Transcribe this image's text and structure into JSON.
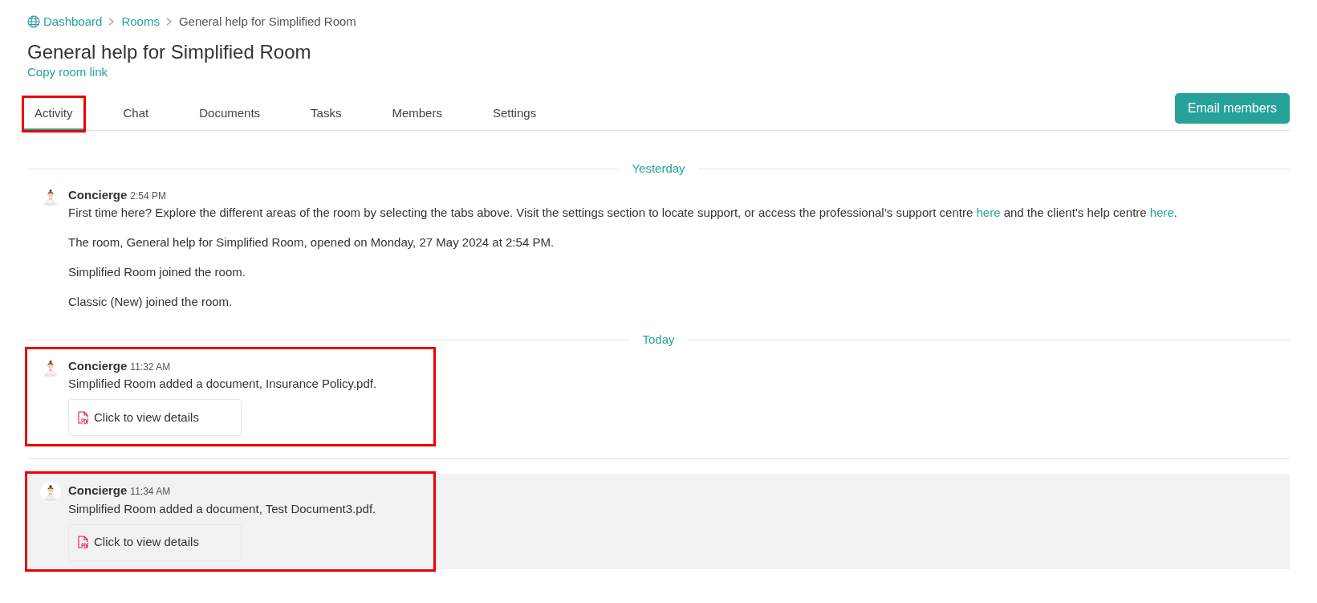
{
  "breadcrumb": [
    {
      "label": "Dashboard",
      "kind": "link"
    },
    {
      "label": "Rooms",
      "kind": "link"
    },
    {
      "label": "General help for Simplified Room",
      "kind": "current"
    }
  ],
  "title": "General help for Simplified Room",
  "copy_link": "Copy room link",
  "tabs": [
    {
      "label": "Activity",
      "selected": true,
      "highlighted": true
    },
    {
      "label": "Chat",
      "selected": false,
      "highlighted": false
    },
    {
      "label": "Documents",
      "selected": false,
      "highlighted": false
    },
    {
      "label": "Tasks",
      "selected": false,
      "highlighted": false
    },
    {
      "label": "Members",
      "selected": false,
      "highlighted": false
    },
    {
      "label": "Settings",
      "selected": false,
      "highlighted": false
    }
  ],
  "email_button": "Email members",
  "days": [
    {
      "label": "Yesterday",
      "events": [
        {
          "author": "Concierge",
          "time": "2:54 PM",
          "selected": false,
          "highlighted": false,
          "paragraphs": [
            [
              {
                "kind": "text",
                "text": "First time here? Explore the different areas of the room by selecting the tabs above. Visit the settings section to locate support, or access the professional’s support centre "
              },
              {
                "kind": "link",
                "text": "here"
              },
              {
                "kind": "text",
                "text": " and the client's help centre "
              },
              {
                "kind": "link",
                "text": "here"
              },
              {
                "kind": "text",
                "text": "."
              }
            ],
            [
              {
                "kind": "text",
                "text": "The room, General help for Simplified Room, opened on Monday, 27 May 2024 at 2:54 PM."
              }
            ],
            [
              {
                "kind": "text",
                "text": "Simplified Room joined the room."
              }
            ],
            [
              {
                "kind": "text",
                "text": "Classic (New) joined the room."
              }
            ]
          ]
        }
      ]
    },
    {
      "label": "Today",
      "events": [
        {
          "author": "Concierge",
          "time": "11:32 AM",
          "selected": false,
          "highlighted": true,
          "paragraphs": [
            [
              {
                "kind": "text",
                "text": "Simplified Room added a document, Insurance Policy.pdf."
              }
            ]
          ],
          "attachment": "Click to view details"
        },
        {
          "author": "Concierge",
          "time": "11:34 AM",
          "selected": true,
          "highlighted": true,
          "paragraphs": [
            [
              {
                "kind": "text",
                "text": "Simplified Room added a document, Test Document3.pdf."
              }
            ]
          ],
          "attachment": "Click to view details"
        }
      ]
    }
  ]
}
